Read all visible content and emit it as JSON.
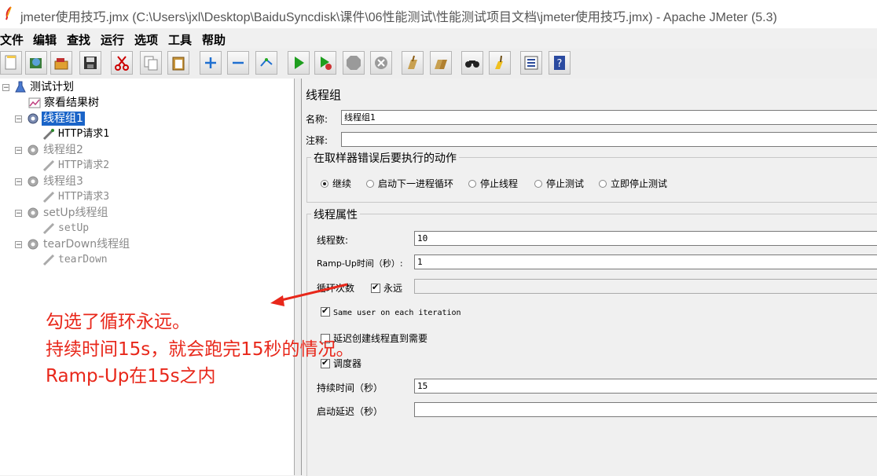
{
  "window": {
    "title": "jmeter使用技巧.jmx (C:\\Users\\jxl\\Desktop\\BaiduSyncdisk\\课件\\06性能测试\\性能测试项目文档\\jmeter使用技巧.jmx) - Apache JMeter (5.3)"
  },
  "menu": [
    "文件",
    "编辑",
    "查找",
    "运行",
    "选项",
    "工具",
    "帮助"
  ],
  "toolbar": [
    "new-icon",
    "templates-icon",
    "open-icon",
    "save-icon",
    "cut-icon",
    "copy-icon",
    "paste-icon",
    "expand-icon",
    "collapse-icon",
    "toggle-icon",
    "start-icon",
    "start-no-pause-icon",
    "stop-icon",
    "shutdown-icon",
    "clear-icon",
    "clear-all-icon",
    "search-icon",
    "reset-search-icon",
    "function-helper-icon",
    "help-icon"
  ],
  "tree": {
    "items": [
      {
        "label": "测试计划",
        "state": "normal",
        "icon": "test-plan-icon"
      },
      {
        "label": "察看结果树",
        "state": "normal",
        "icon": "listener-icon"
      },
      {
        "label": "线程组1",
        "state": "selected",
        "icon": "thread-group-icon"
      },
      {
        "label": "HTTP请求1",
        "state": "normal",
        "icon": "sampler-icon"
      },
      {
        "label": "线程组2",
        "state": "disabled",
        "icon": "thread-group-icon"
      },
      {
        "label": "HTTP请求2",
        "state": "disabled",
        "icon": "sampler-icon"
      },
      {
        "label": "线程组3",
        "state": "disabled",
        "icon": "thread-group-icon"
      },
      {
        "label": "HTTP请求3",
        "state": "disabled",
        "icon": "sampler-icon"
      },
      {
        "label": "setUp线程组",
        "state": "disabled",
        "icon": "thread-group-icon"
      },
      {
        "label": "setUp",
        "state": "disabled",
        "icon": "sampler-icon"
      },
      {
        "label": "tearDown线程组",
        "state": "disabled",
        "icon": "thread-group-icon"
      },
      {
        "label": "tearDown",
        "state": "disabled",
        "icon": "sampler-icon"
      }
    ]
  },
  "panel": {
    "title": "线程组",
    "name_label": "名称:",
    "name_value": "线程组1",
    "comment_label": "注释:",
    "comment_value": "",
    "error_group": {
      "title": "在取样器错误后要执行的动作",
      "options": [
        {
          "label": "继续",
          "selected": true
        },
        {
          "label": "启动下一进程循环",
          "selected": false
        },
        {
          "label": "停止线程",
          "selected": false
        },
        {
          "label": "停止测试",
          "selected": false
        },
        {
          "label": "立即停止测试",
          "selected": false
        }
      ]
    },
    "props_group": {
      "title": "线程属性",
      "threads_label": "线程数:",
      "threads_value": "10",
      "rampup_label": "Ramp-Up时间（秒）:",
      "rampup_value": "1",
      "loop_label": "循环次数",
      "forever_label": "永远",
      "forever_checked": true,
      "loop_value": "",
      "same_user_label": "Same user on each iteration",
      "same_user_checked": true,
      "delay_label": "延迟创建线程直到需要",
      "delay_checked": false,
      "scheduler_label": "调度器",
      "scheduler_checked": true,
      "duration_label": "持续时间（秒）",
      "duration_value": "15",
      "startup_delay_label": "启动延迟（秒）",
      "startup_delay_value": ""
    }
  },
  "annotation": {
    "lines": [
      "勾选了循环永远。",
      "持续时间15s，就会跑完15秒的情况。",
      "Ramp-Up在15s之内"
    ],
    "color": "#e8271a"
  }
}
